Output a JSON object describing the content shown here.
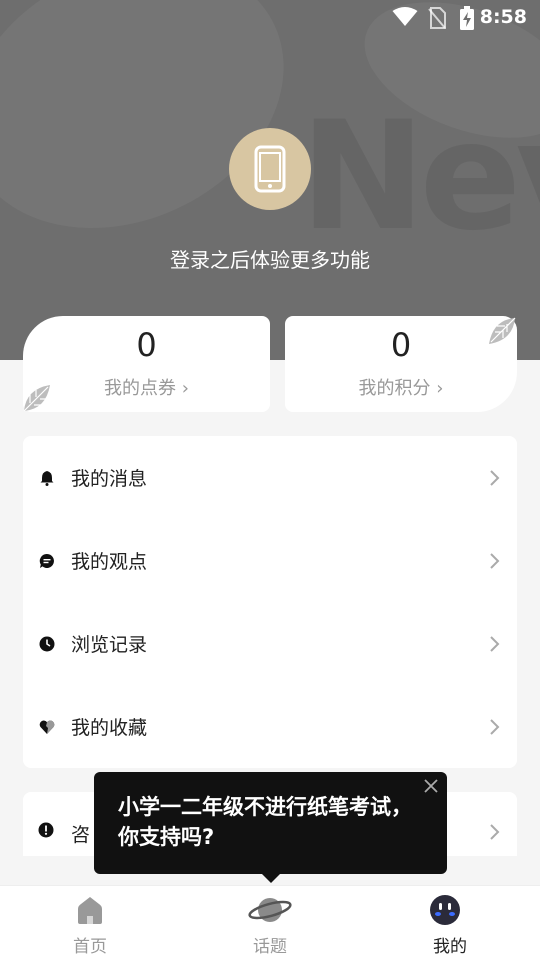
{
  "status_bar": {
    "time": "8:58"
  },
  "header": {
    "login_tip": "登录之后体验更多功能"
  },
  "cards": [
    {
      "value": "0",
      "label": "我的点券 ›"
    },
    {
      "value": "0",
      "label": "我的积分 ›"
    }
  ],
  "menu": {
    "items": [
      {
        "label": "我的消息",
        "icon": "bell-icon"
      },
      {
        "label": "我的观点",
        "icon": "comment-icon"
      },
      {
        "label": "浏览记录",
        "icon": "clock-icon"
      },
      {
        "label": "我的收藏",
        "icon": "heart-icon"
      }
    ]
  },
  "menu2": {
    "label": "咨",
    "icon": "alert-icon"
  },
  "popup": {
    "text": "小学一二年级不进行纸笔考试，你支持吗?"
  },
  "bottom_nav": {
    "items": [
      {
        "label": "首页",
        "icon": "home-icon"
      },
      {
        "label": "话题",
        "icon": "planet-icon"
      },
      {
        "label": "我的",
        "icon": "profile-face-icon",
        "active": true
      }
    ]
  }
}
